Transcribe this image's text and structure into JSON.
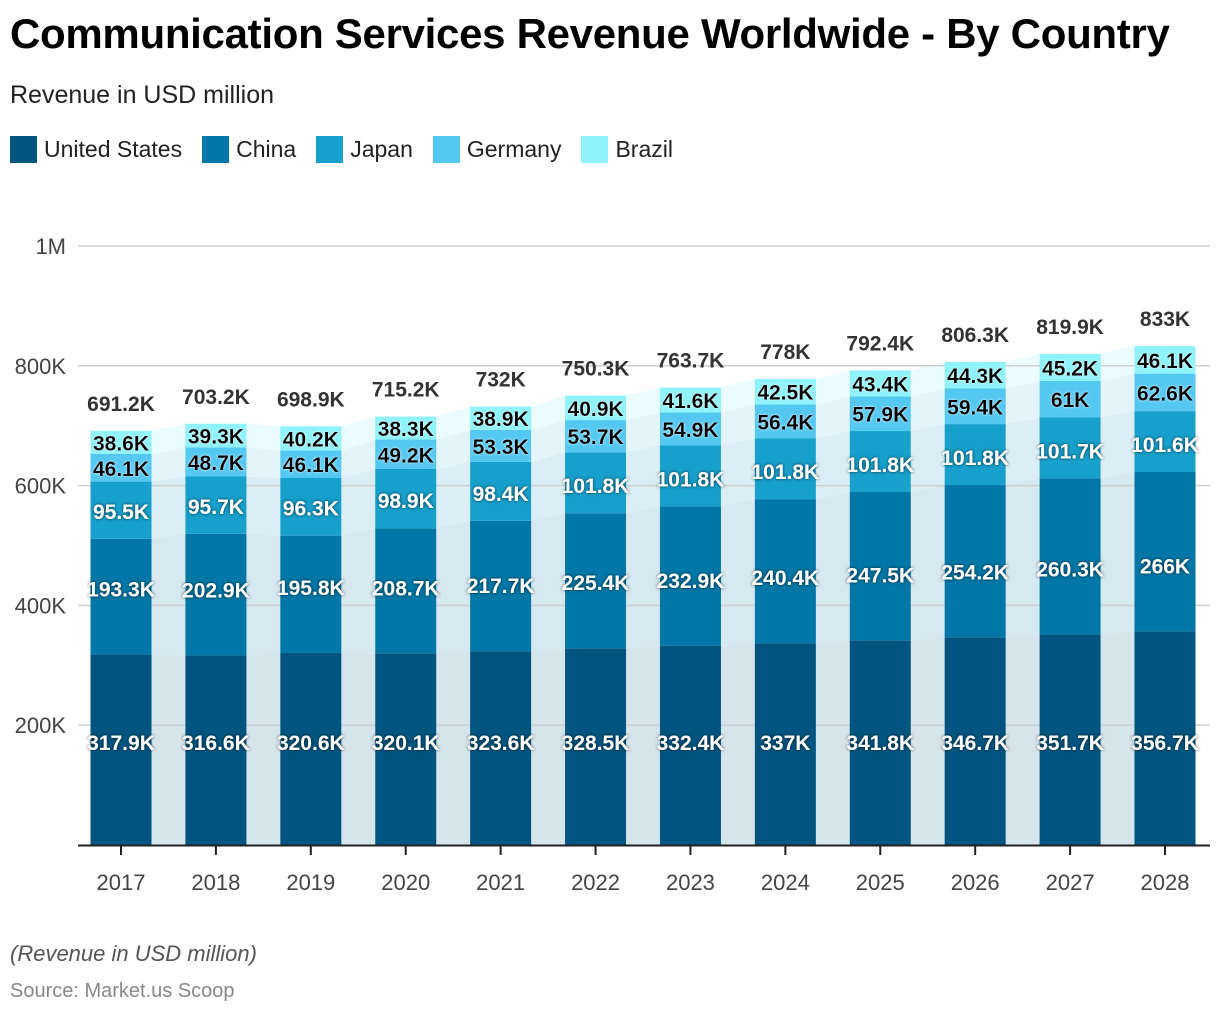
{
  "header": {
    "title": "Communication Services Revenue Worldwide - By Country",
    "subtitle": "Revenue in USD million"
  },
  "footer": {
    "note": "(Revenue in USD million)",
    "source": "Source: Market.us Scoop"
  },
  "chart_data": {
    "type": "bar",
    "stacked": true,
    "title": "Communication Services Revenue Worldwide - By Country",
    "subtitle": "Revenue in USD million",
    "xlabel": "",
    "ylabel": "",
    "ylim": [
      0,
      1000000
    ],
    "yticks": [
      200000,
      400000,
      600000,
      800000,
      1000000
    ],
    "ytick_labels": [
      "200K",
      "400K",
      "600K",
      "800K",
      "1M"
    ],
    "grid": true,
    "legend": "top-left",
    "categories": [
      "2017",
      "2018",
      "2019",
      "2020",
      "2021",
      "2022",
      "2023",
      "2024",
      "2025",
      "2026",
      "2027",
      "2028"
    ],
    "series": [
      {
        "name": "United States",
        "color": "#005580",
        "values": [
          317.9,
          316.6,
          320.6,
          320.1,
          323.6,
          328.5,
          332.4,
          337,
          341.8,
          346.7,
          351.7,
          356.7
        ],
        "labels": [
          "317.9K",
          "316.6K",
          "320.6K",
          "320.1K",
          "323.6K",
          "328.5K",
          "332.4K",
          "337K",
          "341.8K",
          "346.7K",
          "351.7K",
          "356.7K"
        ]
      },
      {
        "name": "China",
        "color": "#0077a6",
        "values": [
          193.3,
          202.9,
          195.8,
          208.7,
          217.7,
          225.4,
          232.9,
          240.4,
          247.5,
          254.2,
          260.3,
          266
        ],
        "labels": [
          "193.3K",
          "202.9K",
          "195.8K",
          "208.7K",
          "217.7K",
          "225.4K",
          "232.9K",
          "240.4K",
          "247.5K",
          "254.2K",
          "260.3K",
          "266K"
        ]
      },
      {
        "name": "Japan",
        "color": "#17a0cc",
        "values": [
          95.5,
          95.7,
          96.3,
          98.9,
          98.4,
          101.8,
          101.8,
          101.8,
          101.8,
          101.8,
          101.7,
          101.6
        ],
        "labels": [
          "95.5K",
          "95.7K",
          "96.3K",
          "98.9K",
          "98.4K",
          "101.8K",
          "101.8K",
          "101.8K",
          "101.8K",
          "101.8K",
          "101.7K",
          "101.6K"
        ]
      },
      {
        "name": "Germany",
        "color": "#55c8f2",
        "values": [
          46.1,
          48.7,
          46.1,
          49.2,
          53.3,
          53.7,
          54.9,
          56.4,
          57.9,
          59.4,
          61,
          62.6
        ],
        "labels": [
          "46.1K",
          "48.7K",
          "46.1K",
          "49.2K",
          "53.3K",
          "53.7K",
          "54.9K",
          "56.4K",
          "57.9K",
          "59.4K",
          "61K",
          "62.6K"
        ]
      },
      {
        "name": "Brazil",
        "color": "#8ff3fb",
        "values": [
          38.6,
          39.3,
          40.2,
          38.3,
          38.9,
          40.9,
          41.6,
          42.5,
          43.4,
          44.3,
          45.2,
          46.1
        ],
        "labels": [
          "38.6K",
          "39.3K",
          "40.2K",
          "38.3K",
          "38.9K",
          "40.9K",
          "41.6K",
          "42.5K",
          "43.4K",
          "44.3K",
          "45.2K",
          "46.1K"
        ]
      }
    ],
    "value_unit": "thousand USD million",
    "totals": [
      691.2,
      703.2,
      698.9,
      715.2,
      732,
      750.3,
      763.7,
      778,
      792.4,
      806.3,
      819.9,
      833
    ],
    "total_labels": [
      "691.2K",
      "703.2K",
      "698.9K",
      "715.2K",
      "732K",
      "750.3K",
      "763.7K",
      "778K",
      "792.4K",
      "806.3K",
      "819.9K",
      "833K"
    ]
  }
}
